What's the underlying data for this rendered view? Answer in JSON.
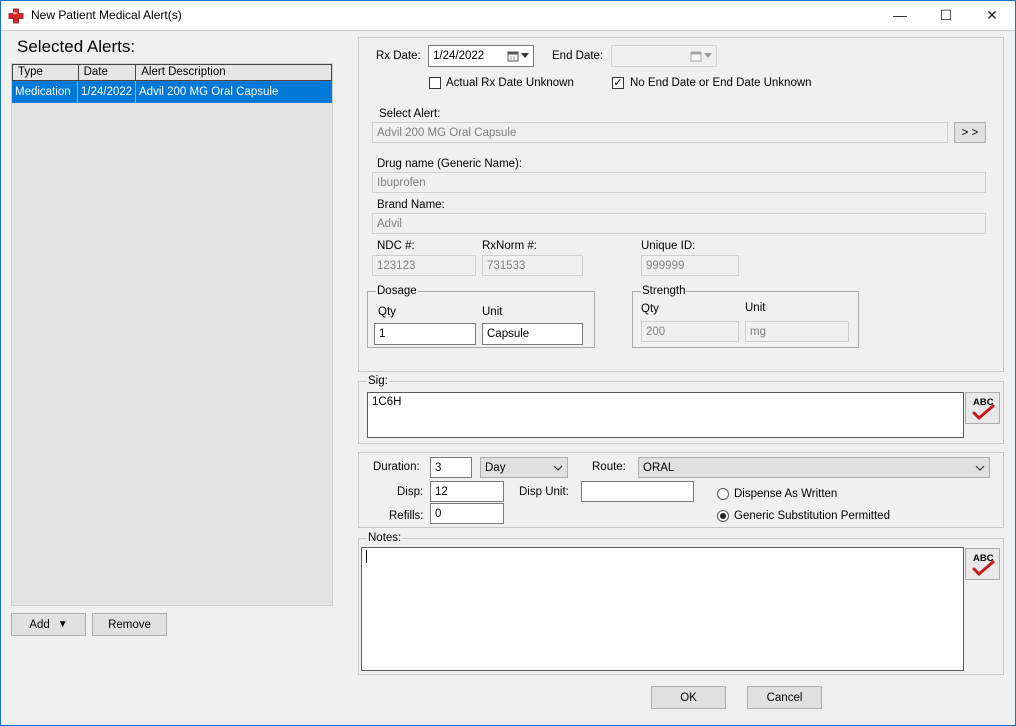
{
  "window": {
    "title": "New Patient Medical Alert(s)",
    "minimize_glyph": "—",
    "maximize_glyph": "☐",
    "close_glyph": "✕"
  },
  "left": {
    "heading": "Selected Alerts:",
    "columns": [
      "Type",
      "Date",
      "Alert Description"
    ],
    "rows": [
      {
        "type": "Medication",
        "date": "1/24/2022",
        "description": "Advil 200 MG Oral Capsule",
        "selected": true
      }
    ],
    "add_label": "Add",
    "add_caret": "▼",
    "remove_label": "Remove"
  },
  "rx": {
    "rx_date_label": "Rx Date:",
    "rx_date_value": "1/24/2022",
    "end_date_label": "End Date:",
    "end_date_value": "",
    "actual_unknown_label": "Actual Rx Date Unknown",
    "actual_unknown_checked": false,
    "no_end_label": "No End Date or End Date Unknown",
    "no_end_checked": true,
    "select_alert_label": "Select Alert:",
    "select_alert_value": "Advil 200 MG Oral Capsule",
    "browse_label": "> >",
    "drug_name_label": "Drug name (Generic Name):",
    "drug_name_value": "Ibuprofen",
    "brand_label": "Brand Name:",
    "brand_value": "Advil",
    "ndc_label": "NDC #:",
    "ndc_value": "123123",
    "rxnorm_label": "RxNorm #:",
    "rxnorm_value": "731533",
    "unique_label": "Unique ID:",
    "unique_value": "999999",
    "dosage": {
      "title": "Dosage",
      "qty_label": "Qty",
      "qty_value": "1",
      "unit_label": "Unit",
      "unit_value": "Capsule"
    },
    "strength": {
      "title": "Strength",
      "qty_label": "Qty",
      "qty_value": "200",
      "unit_label": "Unit",
      "unit_value": "mg"
    }
  },
  "sig": {
    "label": "Sig:",
    "value": "1C6H"
  },
  "spellcheck_label": "ABC",
  "dispense": {
    "duration_label": "Duration:",
    "duration_value": "3",
    "duration_unit": "Day",
    "route_label": "Route:",
    "route_value": "ORAL",
    "disp_label": "Disp:",
    "disp_value": "12",
    "disp_unit_label": "Disp Unit:",
    "disp_unit_value": "",
    "refills_label": "Refills:",
    "refills_value": "0",
    "daw_label": "Dispense As Written",
    "daw_selected": false,
    "generic_label": "Generic Substitution Permitted",
    "generic_selected": true
  },
  "notes": {
    "label": "Notes:",
    "value": ""
  },
  "footer": {
    "ok_label": "OK",
    "cancel_label": "Cancel"
  },
  "colors": {
    "accent": "#0078d7",
    "window_border": "#1874d2",
    "icon_red": "#d9262b"
  }
}
